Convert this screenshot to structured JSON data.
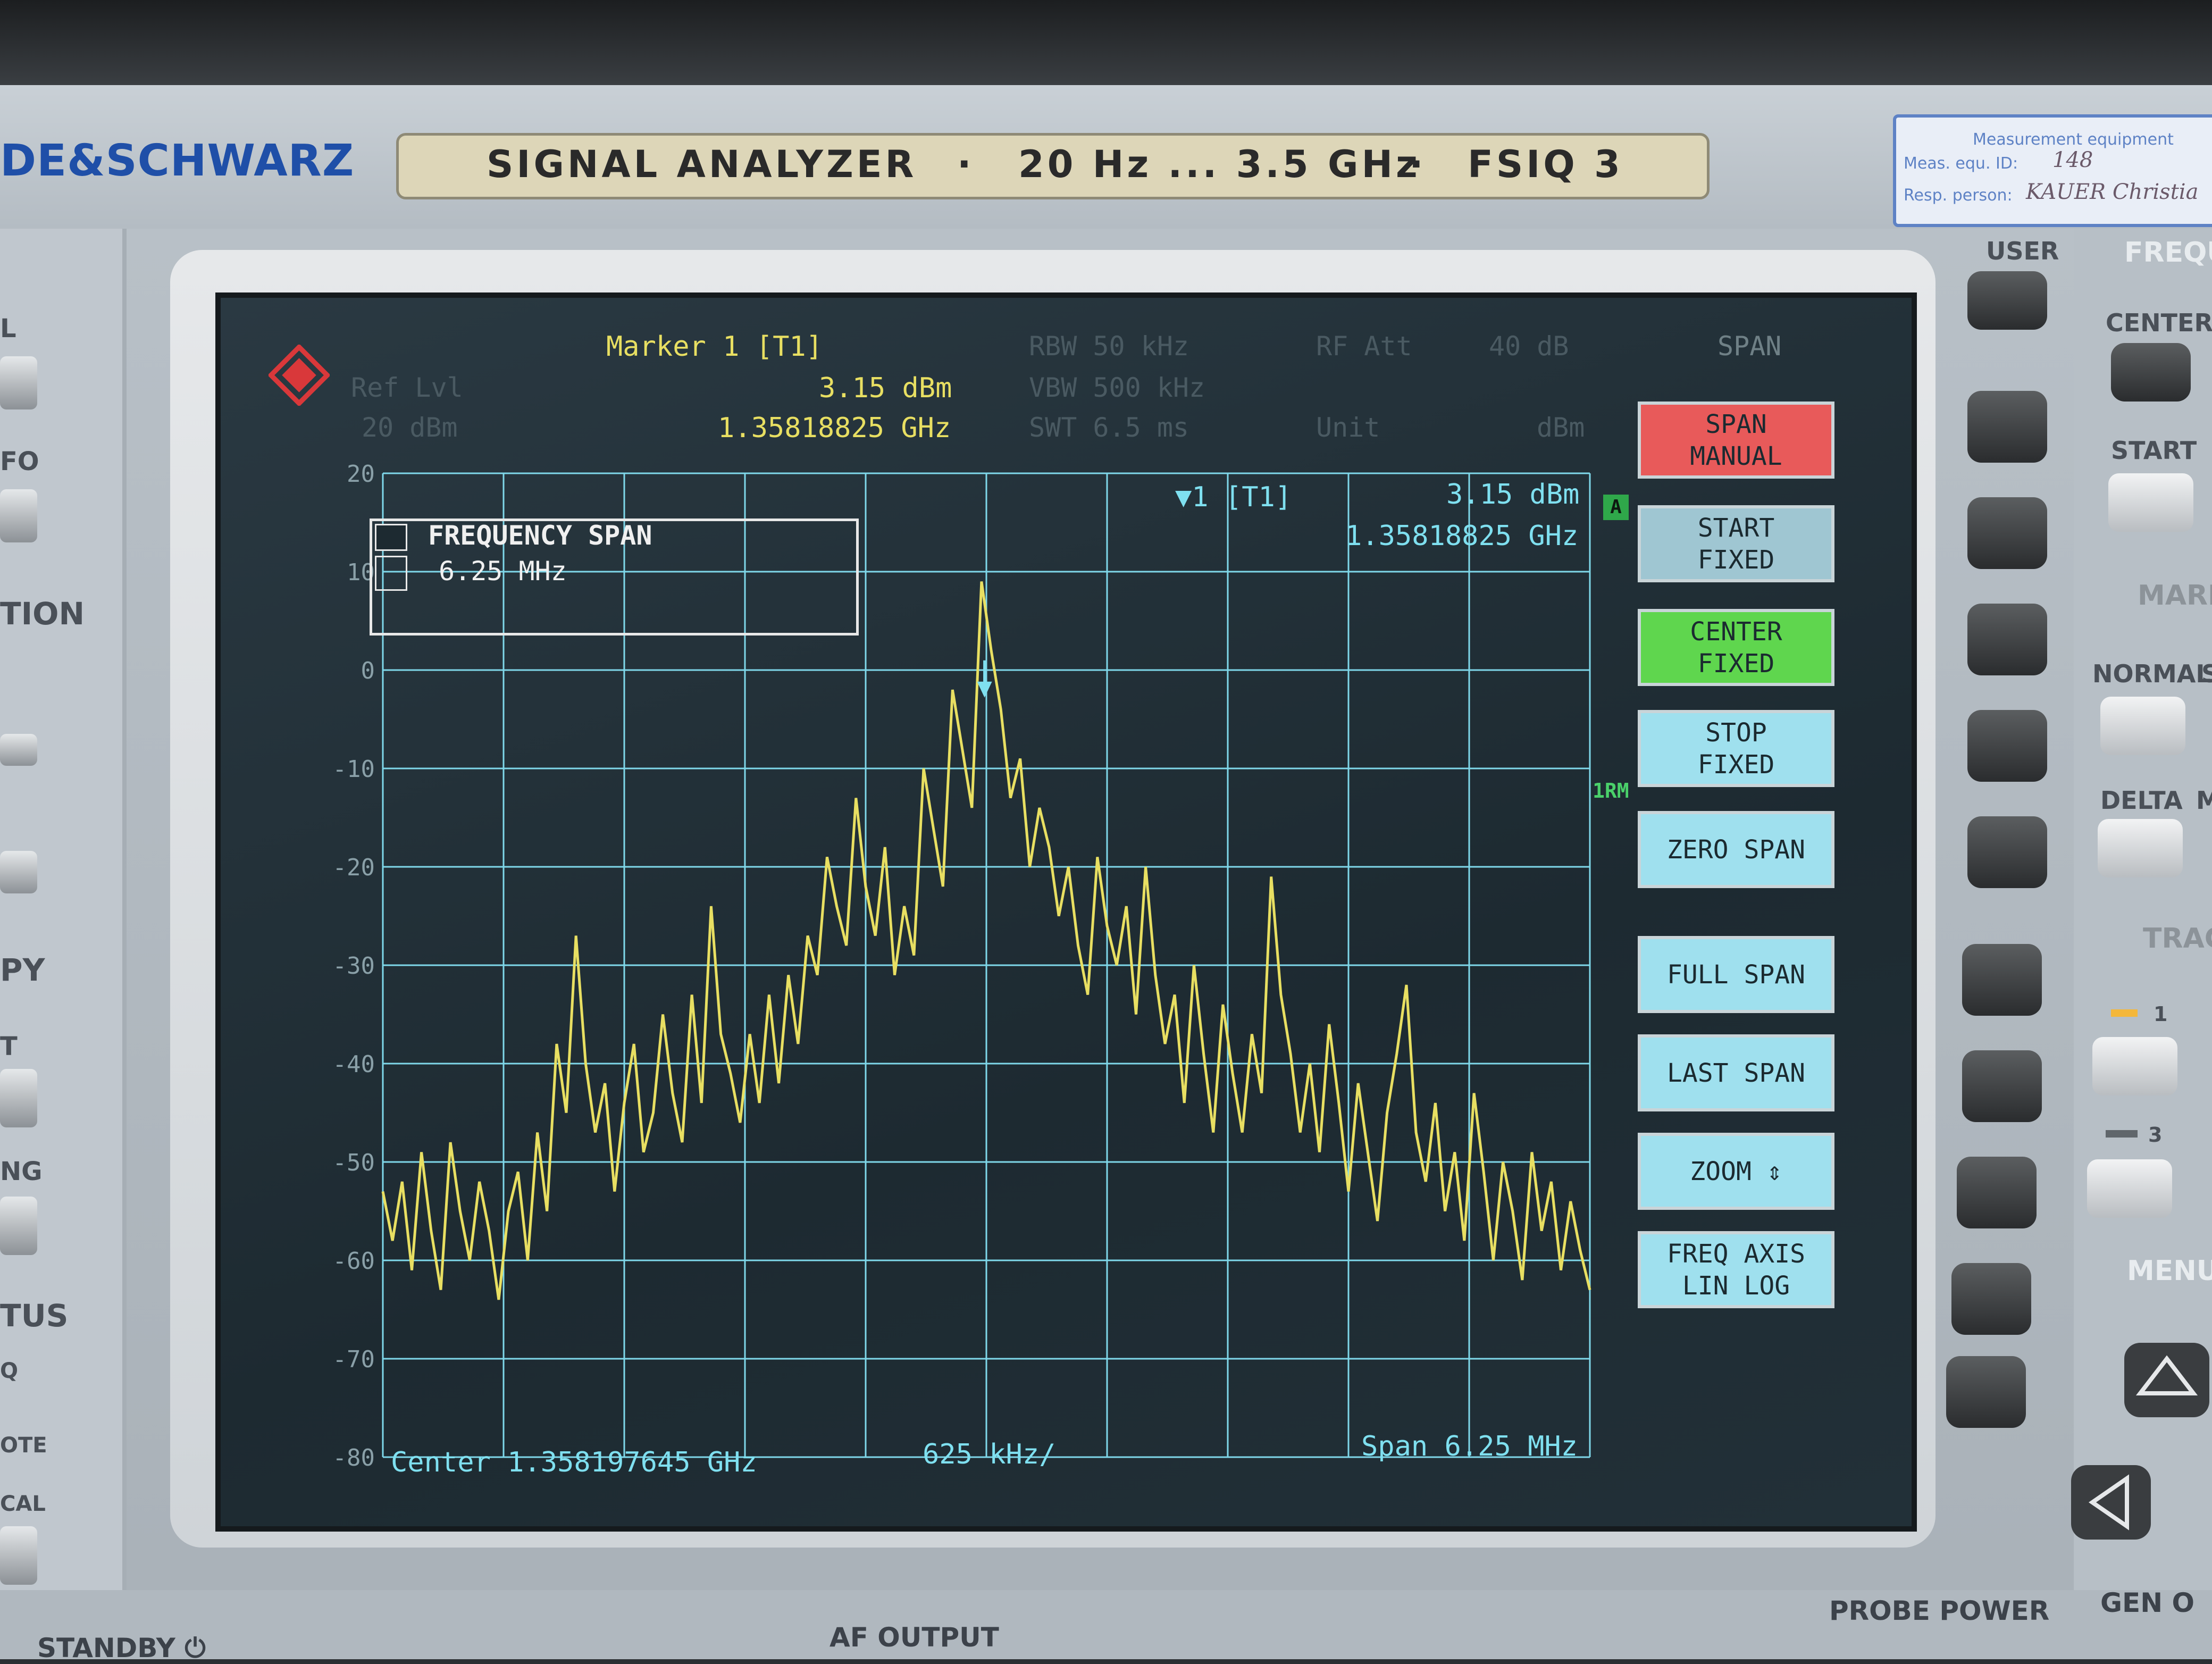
{
  "panel": {
    "brand": "DE&SCHWARZ",
    "model_plate": {
      "name": "SIGNAL ANALYZER",
      "range": "20 Hz ... 3.5 GHz",
      "model": "FSIQ 3",
      "sep": "·"
    },
    "label_sticker": {
      "title": "Measurement equipment",
      "id_label": "Meas. equ. ID:",
      "id_value": "148",
      "person_label": "Resp. person:",
      "person_value": "KAUER Christia"
    },
    "left_labels": [
      "L",
      "FO",
      "TION",
      "PY",
      "T",
      "NG",
      "TUS",
      "Q",
      "OTE",
      "CAL"
    ],
    "right_labels": {
      "user": "USER",
      "freq": "FREQU",
      "center": "CENTER",
      "start": "START",
      "mark": "MARK",
      "normal": "NORMAL",
      "normal_s": "S",
      "delta": "DELTA",
      "delta_m": "M",
      "trace": "TRAC",
      "trace1": "1",
      "trace3": "3",
      "menu": "MENU"
    },
    "bottom_labels": {
      "standby": "STANDBY ⏻",
      "af_output": "AF OUTPUT",
      "probe_power": "PROBE POWER",
      "gen": "GEN O"
    }
  },
  "screen": {
    "header": {
      "marker_title": "Marker 1 [T1]",
      "marker_level": "3.15 dBm",
      "marker_freq": "1.35818825 GHz",
      "rbw": "RBW    50 kHz",
      "vbw": "VBW   500 kHz",
      "swt": "SWT   6.5 ms",
      "rf_att": "RF Att",
      "rf_att_val": "40 dB",
      "unit": "Unit",
      "unit_val": "dBm",
      "ref_lvl": "Ref Lvl",
      "ref_val": "20 dBm"
    },
    "freq_span_box": {
      "title": "FREQUENCY SPAN",
      "value": "6.25 MHz"
    },
    "marker_readout": {
      "label": "▼1 [T1]",
      "level": "3.15 dBm",
      "freq": "1.35818825 GHz"
    },
    "badges": {
      "a": "A",
      "rm": "1RM"
    },
    "footer": {
      "center": "Center 1.358197645 GHz",
      "div": "625 kHz/",
      "span": "Span 6.25 MHz"
    },
    "softkeys": {
      "title": "SPAN",
      "items": [
        {
          "line1": "SPAN",
          "line2": "MANUAL",
          "color": "#e85a5a"
        },
        {
          "line1": "START",
          "line2": "FIXED",
          "color": "#9fc6d2"
        },
        {
          "line1": "CENTER",
          "line2": "FIXED",
          "color": "#5fd64e"
        },
        {
          "line1": "STOP",
          "line2": "FIXED",
          "color": "#9fe0ee"
        },
        {
          "line1": "ZERO SPAN",
          "line2": "",
          "color": "#9fe0ee"
        },
        {
          "line1": "FULL SPAN",
          "line2": "",
          "color": "#9fe0ee"
        },
        {
          "line1": "LAST SPAN",
          "line2": "",
          "color": "#9fe0ee"
        },
        {
          "line1": "ZOOM ⇕",
          "line2": "",
          "color": "#9fe0ee"
        },
        {
          "line1": "FREQ AXIS",
          "line2": "LIN  LOG",
          "color": "#9fe0ee"
        }
      ]
    }
  },
  "chart_data": {
    "type": "line",
    "title": "",
    "xlabel": "Center 1.358197645 GHz",
    "ylabel": "dBm",
    "x_center_ghz": 1.358197645,
    "span_mhz": 6.25,
    "x_div": "625 kHz/",
    "ylim": [
      -80,
      20
    ],
    "yticks": [
      "20",
      "10",
      "0",
      "-10",
      "-20",
      "-30",
      "-40",
      "-50",
      "-60",
      "-70",
      "-80"
    ],
    "grid": true,
    "series": [
      {
        "color": "#e8df62",
        "values": [
          -53,
          -58,
          -52,
          -61,
          -49,
          -57,
          -63,
          -48,
          -55,
          -60,
          -52,
          -57,
          -64,
          -55,
          -51,
          -60,
          -47,
          -55,
          -38,
          -45,
          -27,
          -40,
          -47,
          -42,
          -53,
          -44,
          -38,
          -49,
          -45,
          -35,
          -43,
          -48,
          -33,
          -44,
          -24,
          -37,
          -41,
          -46,
          -37,
          -44,
          -33,
          -42,
          -31,
          -38,
          -27,
          -31,
          -19,
          -24,
          -28,
          -13,
          -22,
          -27,
          -18,
          -31,
          -24,
          -29,
          -10,
          -16,
          -22,
          -2,
          -8,
          -14,
          9,
          2,
          -4,
          -13,
          -9,
          -20,
          -14,
          -18,
          -25,
          -20,
          -28,
          -33,
          -19,
          -26,
          -30,
          -24,
          -35,
          -20,
          -31,
          -38,
          -33,
          -44,
          -30,
          -39,
          -47,
          -34,
          -41,
          -47,
          -37,
          -43,
          -21,
          -33,
          -39,
          -47,
          -40,
          -49,
          -36,
          -44,
          -53,
          -42,
          -49,
          -56,
          -45,
          -39,
          -32,
          -47,
          -52,
          -44,
          -55,
          -49,
          -58,
          -43,
          -51,
          -60,
          -50,
          -55,
          -62,
          -49,
          -57,
          -52,
          -61,
          -54,
          -59,
          -63
        ]
      }
    ],
    "marker": {
      "label": "M1",
      "freq_ghz": 1.35818825,
      "level_dbm": 3.15
    }
  }
}
